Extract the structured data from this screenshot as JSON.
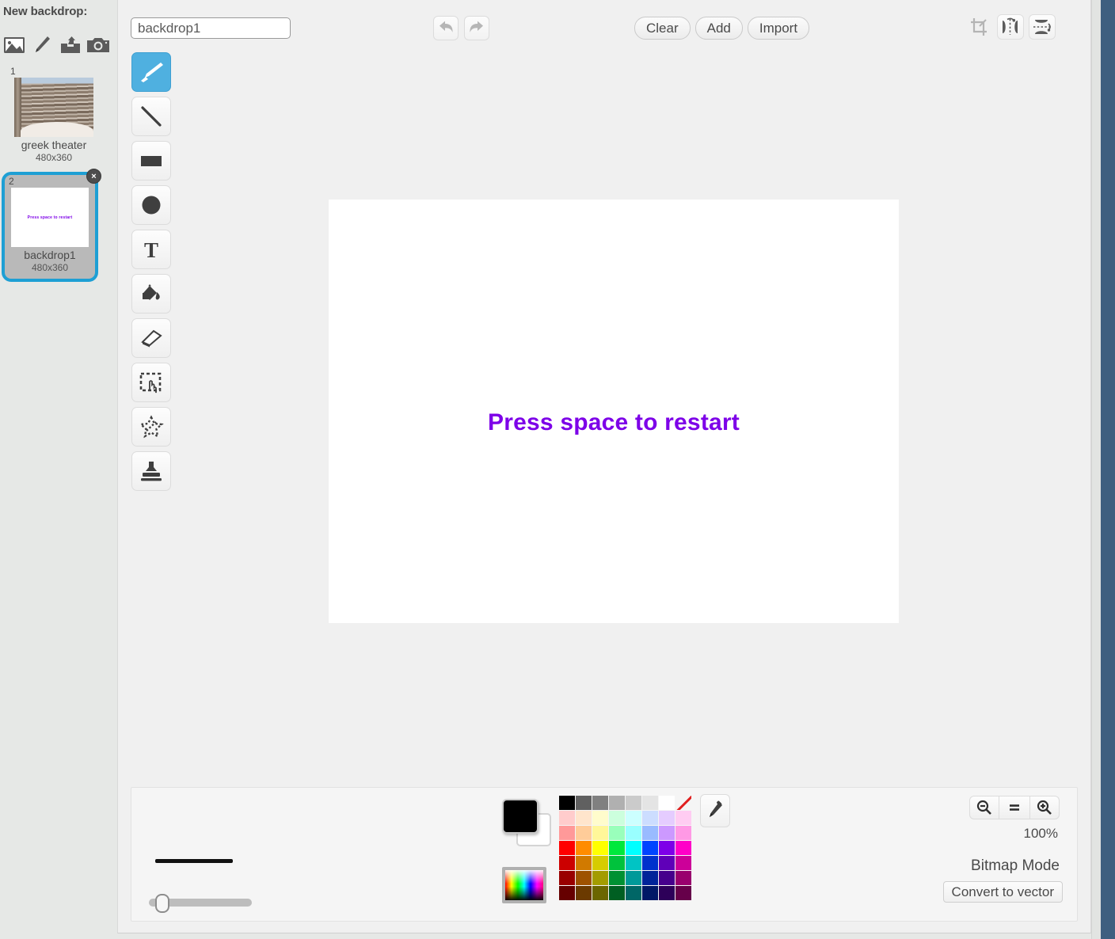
{
  "sidebar": {
    "title": "New backdrop:",
    "new_icons": [
      {
        "name": "library-icon",
        "label": "Choose backdrop from library"
      },
      {
        "name": "paint-icon",
        "label": "Paint new backdrop"
      },
      {
        "name": "upload-icon",
        "label": "Upload backdrop from file"
      },
      {
        "name": "camera-icon",
        "label": "New backdrop from camera"
      }
    ],
    "backdrops": [
      {
        "index": "1",
        "name": "greek theater",
        "size": "480x360",
        "selected": false
      },
      {
        "index": "2",
        "name": "backdrop1",
        "size": "480x360",
        "selected": true,
        "thumb_text": "Press space to restart"
      }
    ],
    "delete_badge": "×"
  },
  "toolbar": {
    "name_value": "backdrop1",
    "name_placeholder": "backdrop1",
    "undo_label": "Undo",
    "redo_label": "Redo",
    "clear_label": "Clear",
    "add_label": "Add",
    "import_label": "Import",
    "crop_label": "Crop",
    "flip_horizontal_label": "Flip horizontal",
    "flip_vertical_label": "Flip vertical"
  },
  "tools": [
    {
      "name": "brush-tool",
      "label": "Brush",
      "active": true
    },
    {
      "name": "line-tool",
      "label": "Line",
      "active": false
    },
    {
      "name": "rectangle-tool",
      "label": "Rectangle",
      "active": false
    },
    {
      "name": "ellipse-tool",
      "label": "Ellipse",
      "active": false
    },
    {
      "name": "text-tool",
      "label": "Text",
      "active": false
    },
    {
      "name": "fill-tool",
      "label": "Fill with color",
      "active": false
    },
    {
      "name": "eraser-tool",
      "label": "Eraser",
      "active": false
    },
    {
      "name": "select-tool",
      "label": "Select",
      "active": false
    },
    {
      "name": "magic-wand-tool",
      "label": "Magic wand",
      "active": false
    },
    {
      "name": "stamp-tool",
      "label": "Stamp",
      "active": false
    }
  ],
  "canvas": {
    "text": "Press space to restart",
    "text_color": "#7d00e8",
    "background": "#ffffff"
  },
  "bottombar": {
    "brush_size_value": 8,
    "primary_color": "#000000",
    "secondary_color": "#ffffff",
    "eyedropper_label": "Eyedropper",
    "zoom_out_label": "Zoom out",
    "zoom_reset_label": "Reset zoom",
    "zoom_in_label": "Zoom in",
    "zoom_percent": "100%",
    "mode_label": "Bitmap Mode",
    "convert_label": "Convert to vector",
    "palette_rows": [
      [
        "#000000",
        "#606060",
        "#808080",
        "#b0b0b0",
        "#cbcbcb",
        "#e4e4e4",
        "#ffffff",
        "transparent"
      ],
      [
        "#ffcccc",
        "#ffe5cc",
        "#fffccc",
        "#ccffdd",
        "#ccffff",
        "#ccddff",
        "#e5ccff",
        "#ffccf2"
      ],
      [
        "#ff9999",
        "#ffcc99",
        "#fff799",
        "#99ffbb",
        "#99ffff",
        "#99bbff",
        "#cc99ff",
        "#ff99e5"
      ],
      [
        "#ff0000",
        "#ff8c00",
        "#ffff00",
        "#00e83c",
        "#00ffff",
        "#0044ff",
        "#7d00e8",
        "#ff00c8"
      ],
      [
        "#cc0000",
        "#d17a00",
        "#d6cc00",
        "#00c23c",
        "#00c4c4",
        "#0032cc",
        "#5f00b8",
        "#cc0099"
      ],
      [
        "#990000",
        "#9e5200",
        "#a39c00",
        "#009133",
        "#009999",
        "#002499",
        "#46008c",
        "#99006e"
      ],
      [
        "#660000",
        "#6b3a00",
        "#6b6600",
        "#005f22",
        "#006666",
        "#001866",
        "#2d0059",
        "#66004a"
      ]
    ]
  }
}
